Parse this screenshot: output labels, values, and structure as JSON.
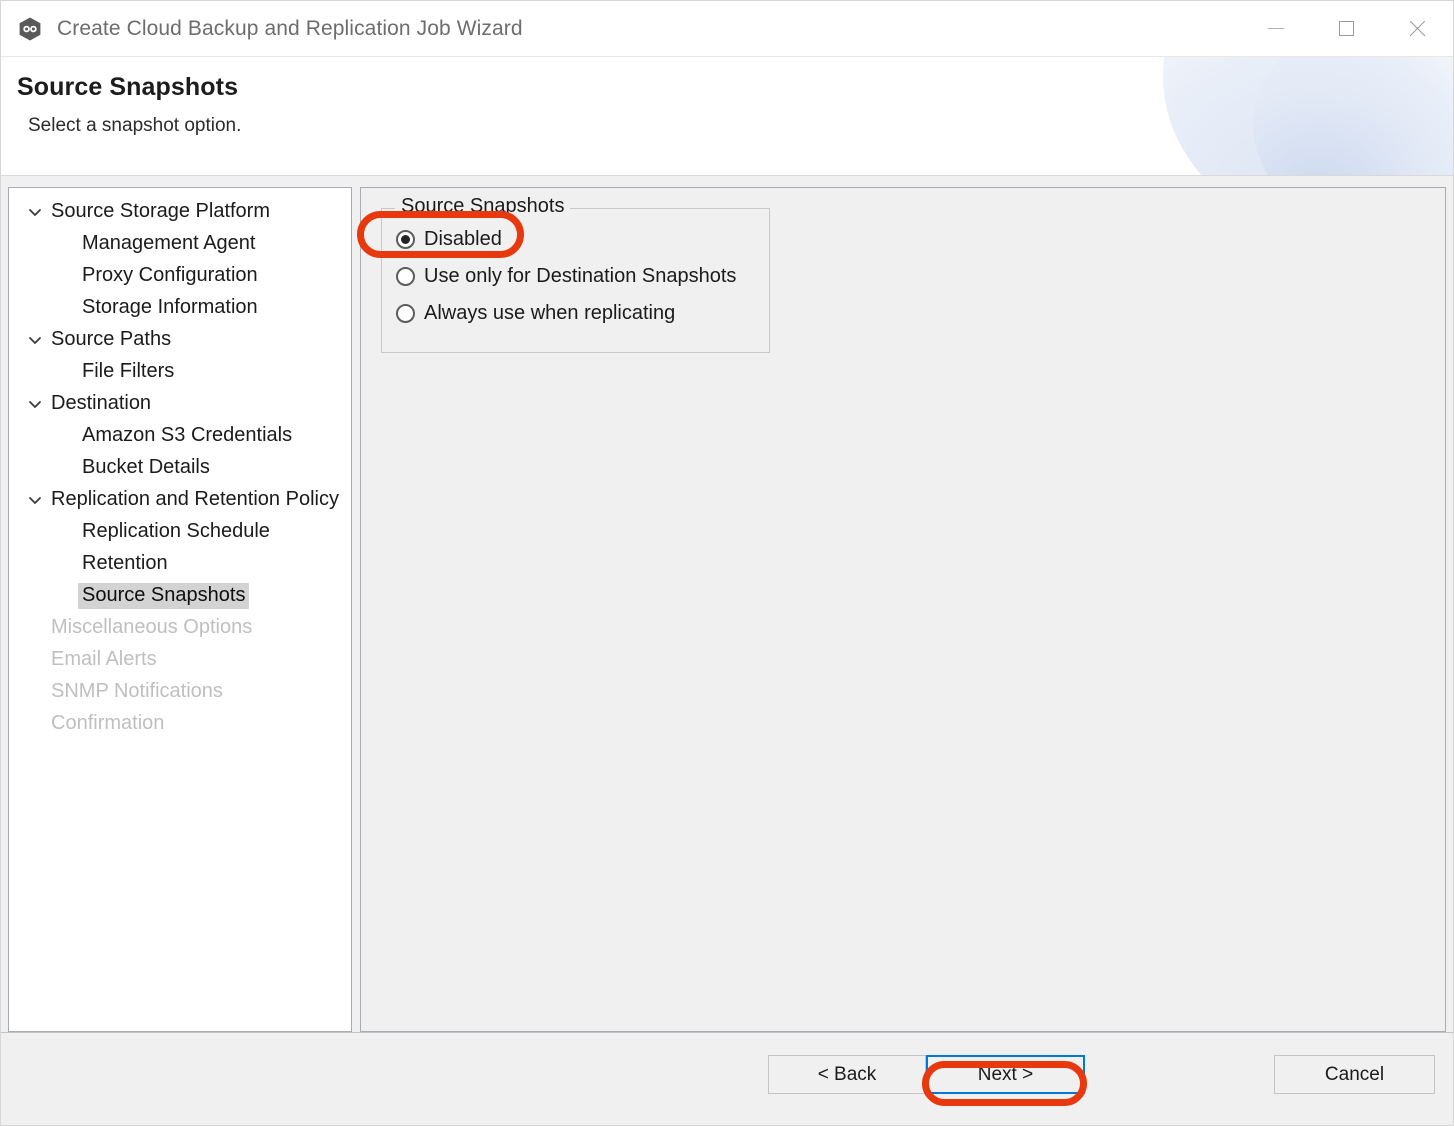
{
  "window": {
    "title": "Create Cloud Backup and Replication Job Wizard",
    "app_icon": "hexagon-link-icon",
    "controls": {
      "minimize": "minimize-icon",
      "maximize": "maximize-icon",
      "close": "close-icon"
    }
  },
  "banner": {
    "title": "Source Snapshots",
    "subtitle": "Select a snapshot option."
  },
  "sidebar": {
    "items": [
      {
        "label": "Source Storage Platform",
        "level": "parent",
        "expanded": true,
        "state": "enabled"
      },
      {
        "label": "Management Agent",
        "level": "child",
        "expanded": false,
        "state": "enabled"
      },
      {
        "label": "Proxy Configuration",
        "level": "child",
        "expanded": false,
        "state": "enabled"
      },
      {
        "label": "Storage Information",
        "level": "child",
        "expanded": false,
        "state": "enabled"
      },
      {
        "label": "Source Paths",
        "level": "parent",
        "expanded": true,
        "state": "enabled"
      },
      {
        "label": "File Filters",
        "level": "child",
        "expanded": false,
        "state": "enabled"
      },
      {
        "label": "Destination",
        "level": "parent",
        "expanded": true,
        "state": "enabled"
      },
      {
        "label": "Amazon S3 Credentials",
        "level": "child",
        "expanded": false,
        "state": "enabled"
      },
      {
        "label": "Bucket Details",
        "level": "child",
        "expanded": false,
        "state": "enabled"
      },
      {
        "label": "Replication and Retention Policy",
        "level": "parent",
        "expanded": true,
        "state": "enabled"
      },
      {
        "label": "Replication Schedule",
        "level": "child",
        "expanded": false,
        "state": "enabled"
      },
      {
        "label": "Retention",
        "level": "child",
        "expanded": false,
        "state": "enabled"
      },
      {
        "label": "Source Snapshots",
        "level": "child",
        "expanded": false,
        "state": "selected"
      },
      {
        "label": "Miscellaneous Options",
        "level": "top",
        "expanded": false,
        "state": "disabled"
      },
      {
        "label": "Email Alerts",
        "level": "top",
        "expanded": false,
        "state": "disabled"
      },
      {
        "label": "SNMP Notifications",
        "level": "top",
        "expanded": false,
        "state": "disabled"
      },
      {
        "label": "Confirmation",
        "level": "top",
        "expanded": false,
        "state": "disabled"
      }
    ],
    "chevron_icon": "chevron-down-icon"
  },
  "main": {
    "groupbox": {
      "title": "Source Snapshots",
      "options": [
        {
          "label": "Disabled",
          "selected": true
        },
        {
          "label": "Use only for Destination Snapshots",
          "selected": false
        },
        {
          "label": "Always use when replicating",
          "selected": false
        }
      ]
    }
  },
  "footer": {
    "back_label": "< Back",
    "next_label": "Next >",
    "cancel_label": "Cancel"
  },
  "annotations": {
    "color": "#e8380d",
    "targets": [
      "Disabled",
      "Next >"
    ]
  },
  "colors": {
    "accent_focus": "#0078d7",
    "panel_bg": "#f0f0f0",
    "selection_bg": "#d3d3d3",
    "disabled_text": "#bfbfbf",
    "annotation": "#e8380d"
  }
}
